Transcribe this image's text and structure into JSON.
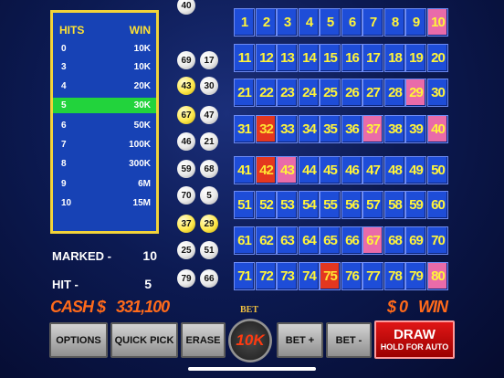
{
  "paytable": {
    "hits_header": "HITS",
    "win_header": "WIN",
    "rows": [
      {
        "hits": "0",
        "win": "10K"
      },
      {
        "hits": "3",
        "win": "10K"
      },
      {
        "hits": "4",
        "win": "20K"
      },
      {
        "hits": "5",
        "win": "30K",
        "active": true
      },
      {
        "hits": "6",
        "win": "50K"
      },
      {
        "hits": "7",
        "win": "100K"
      },
      {
        "hits": "8",
        "win": "300K"
      },
      {
        "hits": "9",
        "win": "6M"
      },
      {
        "hits": "10",
        "win": "15M"
      }
    ]
  },
  "called_balls": {
    "top_partial": "40",
    "column_left": [
      "69",
      "43",
      "67",
      "46",
      "59",
      "70",
      "37",
      "25",
      "79"
    ],
    "column_right": [
      "17",
      "30",
      "47",
      "21",
      "68",
      "5",
      "29",
      "51",
      "66"
    ],
    "highlighted": [
      "43",
      "67",
      "37",
      "29"
    ]
  },
  "board": {
    "numbers_from": 1,
    "numbers_to": 80,
    "selected": [
      10,
      29,
      37,
      40,
      43,
      67,
      80
    ],
    "hits": [
      32,
      42,
      75
    ]
  },
  "stats": {
    "marked_label": "MARKED -",
    "marked_value": "10",
    "hit_label": "HIT -",
    "hit_value": "5",
    "cash_label": "CASH $",
    "cash_value": "331,100",
    "win_amount": "$ 0",
    "win_label": "WIN"
  },
  "controls": {
    "options": "OPTIONS",
    "quick_pick": "QUICK PICK",
    "erase": "ERASE",
    "bet_title": "BET",
    "bet_value": "10K",
    "bet_plus": "BET +",
    "bet_minus": "BET -",
    "draw": "DRAW",
    "draw_sub": "HOLD FOR AUTO"
  },
  "colors": {
    "cell_blue": "#1e4dd8",
    "cell_selected": "#e96ba9",
    "cell_hit": "#e4371f",
    "paytable_active": "#22d33c",
    "accent_orange": "#ff6a1a"
  }
}
